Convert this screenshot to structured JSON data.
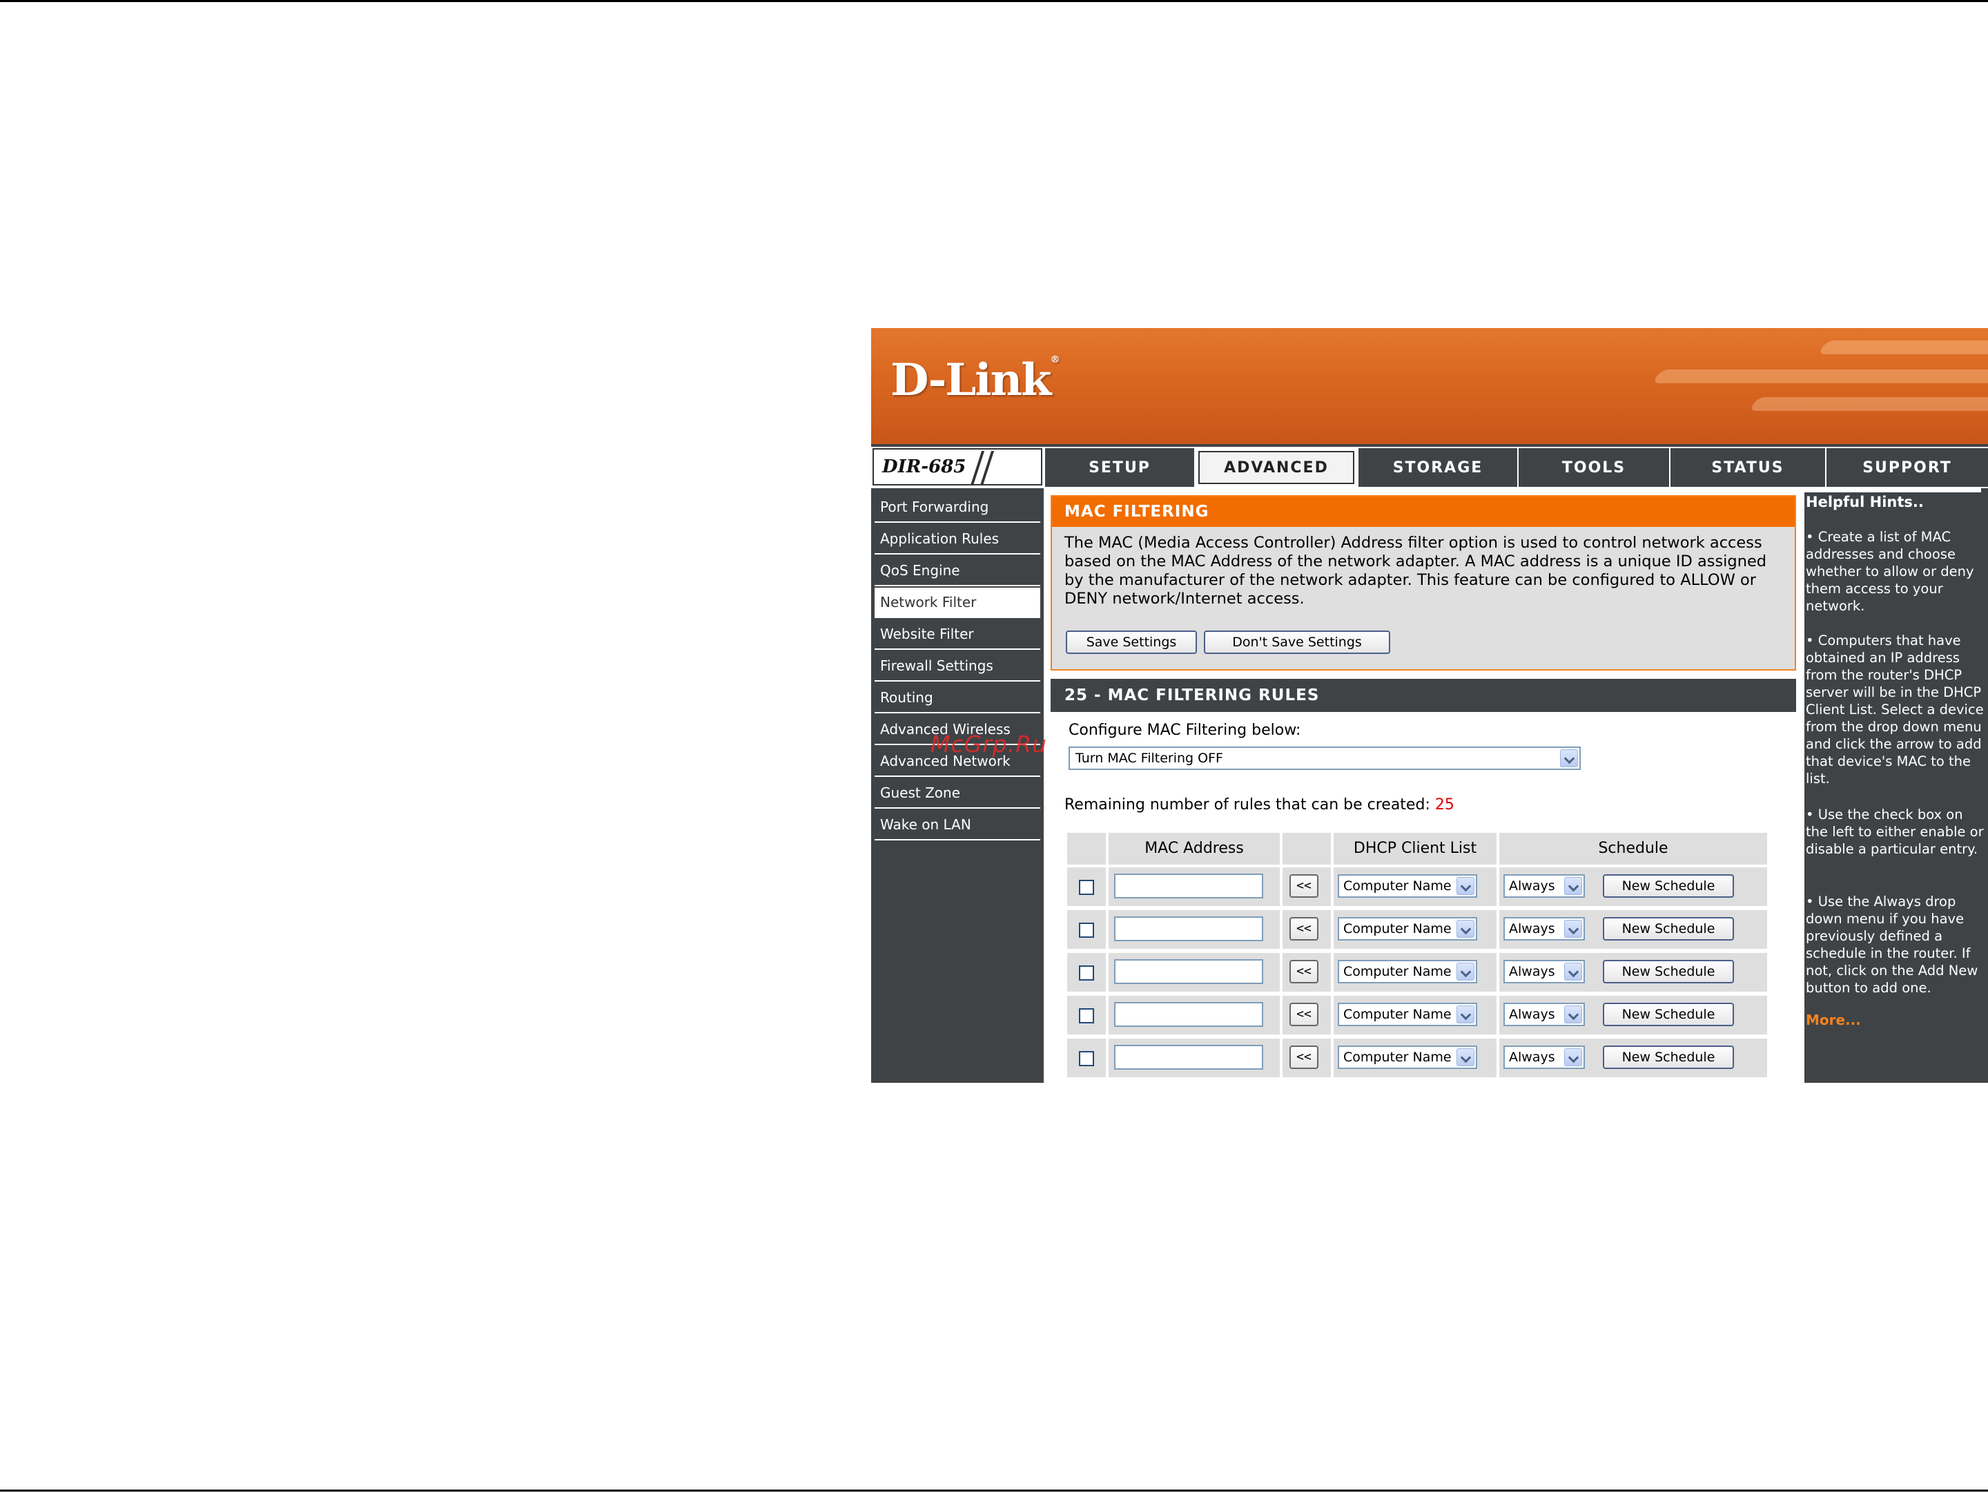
{
  "brand": {
    "logo": "D-Link",
    "model": "DIR-685"
  },
  "nav": {
    "tabs": [
      "SETUP",
      "ADVANCED",
      "STORAGE",
      "TOOLS",
      "STATUS",
      "SUPPORT"
    ],
    "active": "ADVANCED"
  },
  "sidebar": {
    "items": [
      "Port Forwarding",
      "Application Rules",
      "QoS Engine",
      "Network Filter",
      "Website Filter",
      "Firewall Settings",
      "Routing",
      "Advanced Wireless",
      "Advanced Network",
      "Guest Zone",
      "Wake on LAN"
    ],
    "active": "Network Filter"
  },
  "mac_filtering": {
    "title": "MAC FILTERING",
    "description": "The MAC (Media Access Controller) Address filter option is used to control network access based on the MAC Address of the network adapter. A MAC address is a unique ID assigned by the manufacturer of the network adapter. This feature can be configured to ALLOW or DENY network/Internet access.",
    "save_label": "Save Settings",
    "dont_save_label": "Don't Save Settings"
  },
  "rules": {
    "title": "25 - MAC FILTERING RULES",
    "configure_label": "Configure MAC Filtering below:",
    "mode_value": "Turn MAC Filtering OFF",
    "remaining_label": "Remaining number of rules that can be created:",
    "remaining_count": "25",
    "columns": {
      "mac": "MAC Address",
      "dhcp": "DHCP Client List",
      "schedule": "Schedule"
    },
    "rows": [
      {
        "mac": "",
        "dhcp": "Computer Name",
        "schedule": "Always",
        "new_schedule": "New Schedule",
        "arrow": "<<"
      },
      {
        "mac": "",
        "dhcp": "Computer Name",
        "schedule": "Always",
        "new_schedule": "New Schedule",
        "arrow": "<<"
      },
      {
        "mac": "",
        "dhcp": "Computer Name",
        "schedule": "Always",
        "new_schedule": "New Schedule",
        "arrow": "<<"
      },
      {
        "mac": "",
        "dhcp": "Computer Name",
        "schedule": "Always",
        "new_schedule": "New Schedule",
        "arrow": "<<"
      },
      {
        "mac": "",
        "dhcp": "Computer Name",
        "schedule": "Always",
        "new_schedule": "New Schedule",
        "arrow": "<<"
      }
    ]
  },
  "hints": {
    "title": "Helpful Hints..",
    "items": [
      "• Create a list of MAC addresses and choose whether to allow or deny them access to your network.",
      "• Computers that have obtained an IP address from the router's DHCP server will be in the DHCP Client List. Select a device from the drop down menu and click the arrow to add that device's MAC to the list.",
      "• Use the check box on the left to either enable or disable a particular entry.",
      "• Use the Always drop down menu if you have previously defined a schedule in the router. If not, click on the Add New button to add one."
    ],
    "more": "More..."
  },
  "watermark": "McGrp.Ru",
  "colors": {
    "orange": "#f26d00",
    "dark": "#3f4346",
    "remaining": "#e00000",
    "more": "#f58220"
  }
}
